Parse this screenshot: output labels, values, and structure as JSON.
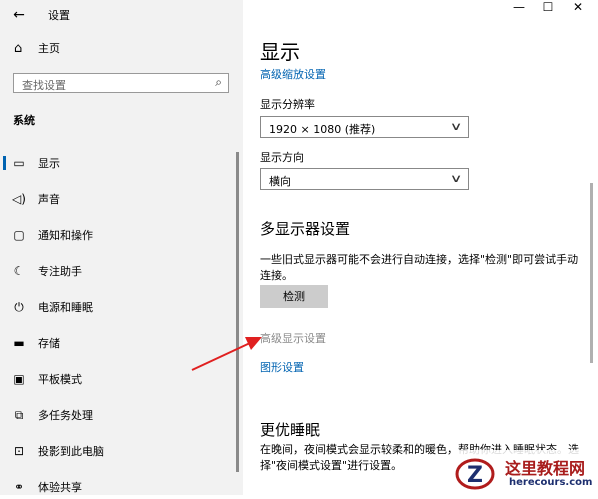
{
  "window": {
    "title": "设置",
    "minimize_glyph": "—",
    "maximize_glyph": "☐",
    "close_glyph": "✕"
  },
  "sidebar": {
    "home_label": "主页",
    "search_placeholder": "查找设置",
    "section_label": "系统",
    "items": [
      {
        "label": "显示",
        "icon": "monitor-icon",
        "active": true
      },
      {
        "label": "声音",
        "icon": "speaker-icon"
      },
      {
        "label": "通知和操作",
        "icon": "notification-icon"
      },
      {
        "label": "专注助手",
        "icon": "moon-icon"
      },
      {
        "label": "电源和睡眠",
        "icon": "power-icon"
      },
      {
        "label": "存储",
        "icon": "storage-icon"
      },
      {
        "label": "平板模式",
        "icon": "tablet-icon"
      },
      {
        "label": "多任务处理",
        "icon": "multitask-icon"
      },
      {
        "label": "投影到此电脑",
        "icon": "project-icon"
      },
      {
        "label": "体验共享",
        "icon": "share-icon"
      }
    ]
  },
  "main": {
    "title": "显示",
    "advanced_scaling_link": "高级缩放设置",
    "resolution_label": "显示分辨率",
    "resolution_value": "1920 × 1080 (推荐)",
    "orientation_label": "显示方向",
    "orientation_value": "横向",
    "multi_display_heading": "多显示器设置",
    "multi_display_desc": "一些旧式显示器可能不会进行自动连接，选择\"检测\"即可尝试手动连接。",
    "detect_button": "检测",
    "advanced_display_link": "高级显示设置",
    "graphics_link": "图形设置",
    "sleep_heading": "更优睡眠",
    "sleep_desc": "在晚间，夜间模式会显示较柔和的暖色，帮助你进入睡眠状态。选择\"夜间模式设置\"进行设置。"
  },
  "watermark": {
    "title": "这里教程网",
    "url": "herecours.com",
    "logo_letter": "Z"
  },
  "colors": {
    "accent": "#0063b1",
    "sidebar_bg": "#f2f2f2",
    "arrow": "#e02020"
  }
}
